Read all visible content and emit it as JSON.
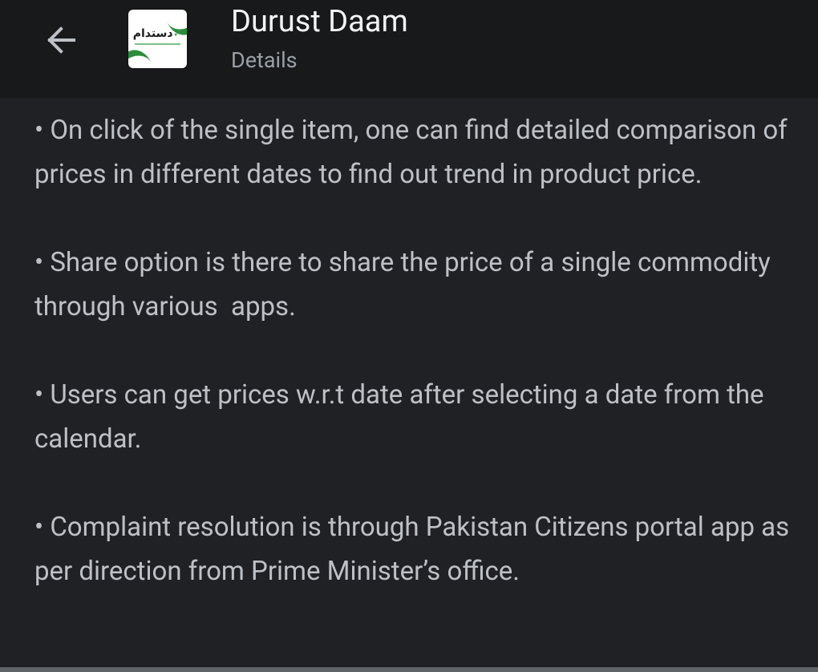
{
  "header": {
    "back_label": "Back",
    "app_icon_text": "دستدام",
    "app_icon_tick": "✓",
    "title": "Durust Daam",
    "subtitle": "Details"
  },
  "details": [
    "• On click of the single item, one can find detailed comparison of prices in different dates to find out trend in product price.",
    "• Share option is there to share the price of a single commodity through various  apps.",
    "• Users can get prices w.r.t date after selecting a date from the calendar.",
    "• Complaint resolution is through Pakistan Citizens portal app as per direction from Prime Minister’s office."
  ],
  "colors": {
    "background": "#202124",
    "header_background": "#18191b",
    "title": "#f1f3f4",
    "body_text": "#bdc1c6",
    "subtitle": "#9aa0a6",
    "brand_green": "#2e8b3d"
  },
  "icons": {
    "back": "arrow-back-icon",
    "app": "durust-daam-app-icon"
  }
}
